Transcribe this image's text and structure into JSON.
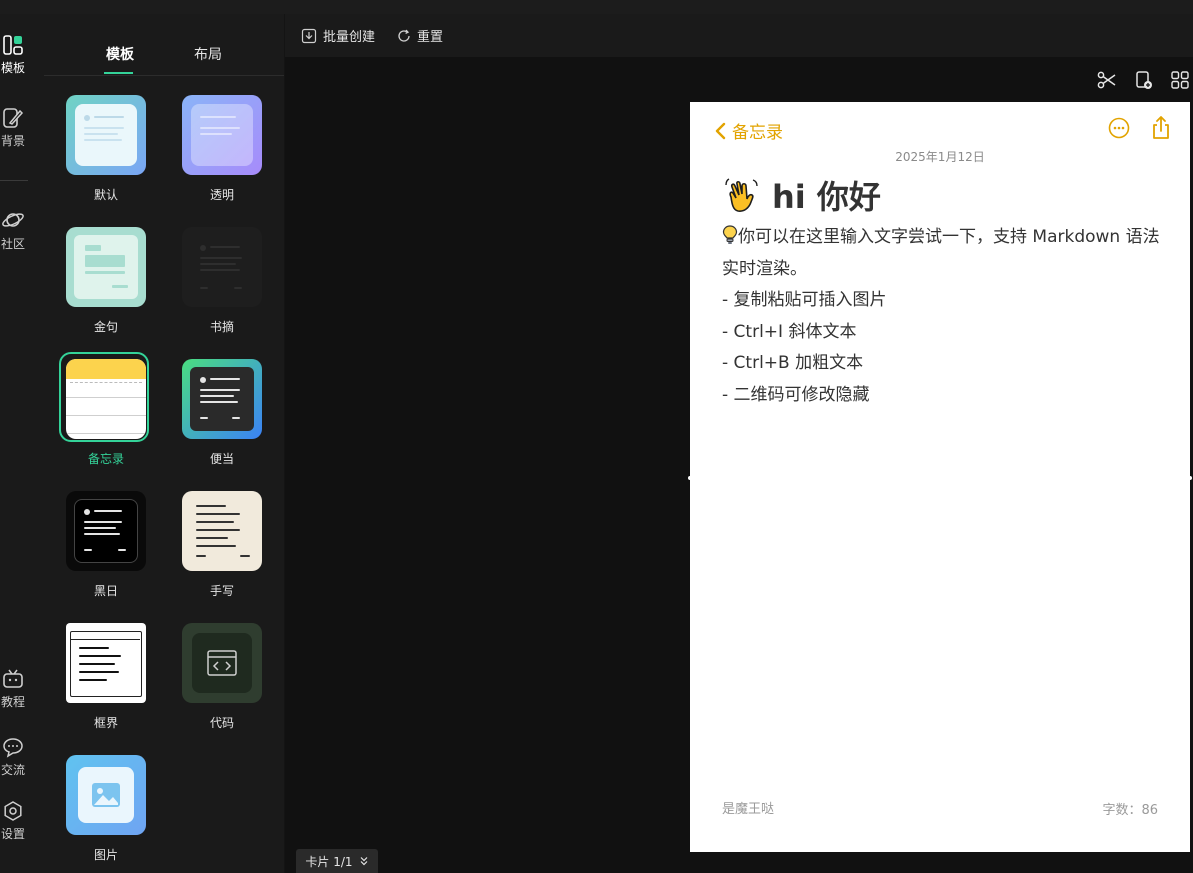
{
  "rail": {
    "items": [
      {
        "label": "模板"
      },
      {
        "label": "背景"
      },
      {
        "label": "社区"
      },
      {
        "label": "教程"
      },
      {
        "label": "交流"
      },
      {
        "label": "设置"
      }
    ]
  },
  "panel": {
    "tabs": [
      {
        "label": "模板"
      },
      {
        "label": "布局"
      }
    ],
    "templates": [
      {
        "name": "默认"
      },
      {
        "name": "透明"
      },
      {
        "name": "金句"
      },
      {
        "name": "书摘"
      },
      {
        "name": "备忘录",
        "selected": true
      },
      {
        "name": "便当"
      },
      {
        "name": "黑日"
      },
      {
        "name": "手写"
      },
      {
        "name": "框界"
      },
      {
        "name": "代码"
      },
      {
        "name": "图片"
      }
    ]
  },
  "toolbar": {
    "batch_label": "批量创建",
    "reset_label": "重置"
  },
  "card": {
    "back_label": "备忘录",
    "date": "2025年1月12日",
    "title_emoji": "waving-hand",
    "title": "hi 你好",
    "intro": "你可以在这里输入文字尝试一下，支持 Markdown 语法实时渲染。",
    "lines": [
      "- 复制粘贴可插入图片",
      "- Ctrl+I 斜体文本",
      "- Ctrl+B 加粗文本",
      "- 二维码可修改隐藏"
    ],
    "author": "是魔王哒",
    "word_count": "字数：86"
  },
  "pager": {
    "label": "卡片 1/1"
  },
  "colors": {
    "accent": "#34d399",
    "memo_yellow": "#e2a300",
    "background": "#141414",
    "panel": "#1a1a1a",
    "card": "#ffffff"
  }
}
